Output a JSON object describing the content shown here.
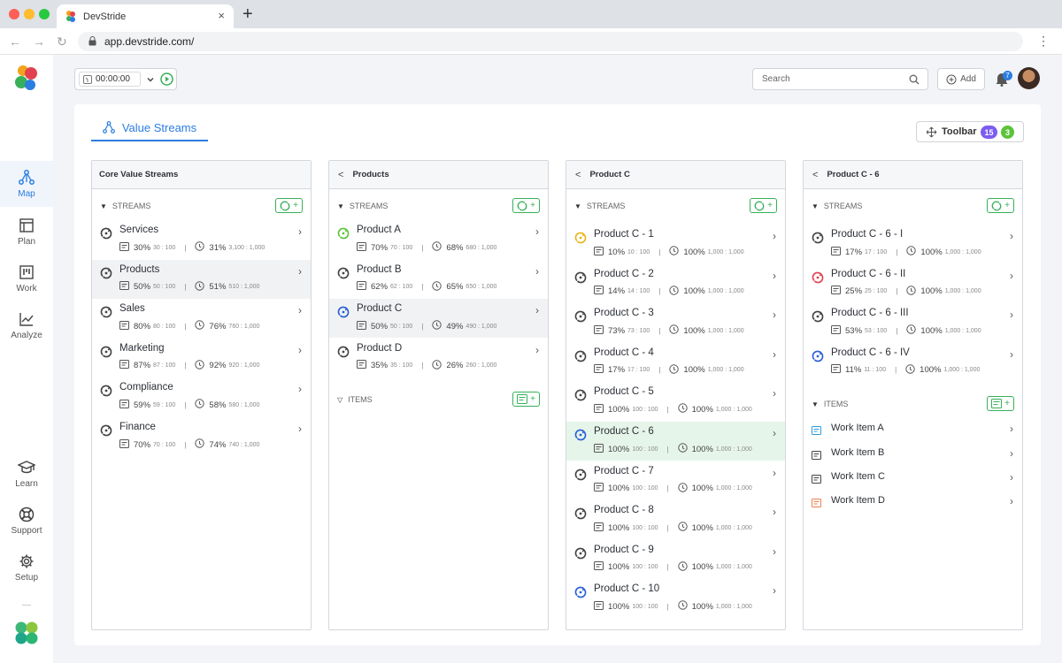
{
  "browser": {
    "tab_title": "DevStride",
    "url": "app.devstride.com/",
    "tab_close": "×",
    "new_tab": "+",
    "nav_back": "←",
    "nav_forward": "→",
    "nav_reload": "↻",
    "menu": "⋮"
  },
  "sidebar": {
    "items": [
      {
        "label": "Map",
        "icon": "map-icon",
        "active": true
      },
      {
        "label": "Plan",
        "icon": "plan-icon"
      },
      {
        "label": "Work",
        "icon": "work-icon"
      },
      {
        "label": "Analyze",
        "icon": "analyze-icon"
      },
      {
        "label": "Learn",
        "icon": "learn-icon"
      },
      {
        "label": "Support",
        "icon": "support-icon"
      },
      {
        "label": "Setup",
        "icon": "setup-icon"
      }
    ]
  },
  "topbar": {
    "timer_value": "00:00:00",
    "search_placeholder": "Search",
    "add_label": "Add",
    "notification_count": "7"
  },
  "page": {
    "tab_label": "Value Streams",
    "toolbar_label": "Toolbar",
    "toolbar_badge_1": "15",
    "toolbar_badge_2": "3"
  },
  "colors": {
    "accent": "#2a7de1",
    "green": "#38b05a",
    "purple": "#7b5cf0",
    "lime": "#5cc33a"
  },
  "columns": [
    {
      "title": "Core Value Streams",
      "back": false,
      "streams_label": "STREAMS",
      "streams": [
        {
          "name": "Services",
          "pct1": "30%",
          "frac1": "30 : 100",
          "pct2": "31%",
          "frac2": "3,100 : 1,000",
          "icon_color": "#444"
        },
        {
          "name": "Products",
          "pct1": "50%",
          "frac1": "50 : 100",
          "pct2": "51%",
          "frac2": "510 : 1,000",
          "icon_color": "#444",
          "state": "hl"
        },
        {
          "name": "Sales",
          "pct1": "80%",
          "frac1": "80 : 100",
          "pct2": "76%",
          "frac2": "760 : 1,000",
          "icon_color": "#444"
        },
        {
          "name": "Marketing",
          "pct1": "87%",
          "frac1": "87 : 100",
          "pct2": "92%",
          "frac2": "920 : 1,000",
          "icon_color": "#444"
        },
        {
          "name": "Compliance",
          "pct1": "59%",
          "frac1": "59 : 100",
          "pct2": "58%",
          "frac2": "580 : 1,000",
          "icon_color": "#444"
        },
        {
          "name": "Finance",
          "pct1": "70%",
          "frac1": "70 : 100",
          "pct2": "74%",
          "frac2": "740 : 1,000",
          "icon_color": "#444"
        }
      ]
    },
    {
      "title": "Products",
      "back": true,
      "streams_label": "STREAMS",
      "items_label": "ITEMS",
      "streams": [
        {
          "name": "Product A",
          "pct1": "70%",
          "frac1": "70 : 100",
          "pct2": "68%",
          "frac2": "680 : 1,000",
          "icon_color": "#5cc33a"
        },
        {
          "name": "Product B",
          "pct1": "62%",
          "frac1": "62 : 100",
          "pct2": "65%",
          "frac2": "650 : 1,000",
          "icon_color": "#444"
        },
        {
          "name": "Product C",
          "pct1": "50%",
          "frac1": "50 : 100",
          "pct2": "49%",
          "frac2": "490 : 1,000",
          "icon_color": "#2a5fd6",
          "state": "hl"
        },
        {
          "name": "Product D",
          "pct1": "35%",
          "frac1": "35 : 100",
          "pct2": "26%",
          "frac2": "260 : 1,000",
          "icon_color": "#444"
        }
      ]
    },
    {
      "title": "Product C",
      "back": true,
      "streams_label": "STREAMS",
      "streams": [
        {
          "name": "Product C - 1",
          "pct1": "10%",
          "frac1": "10 : 100",
          "pct2": "100%",
          "frac2": "1,000 : 1,000",
          "icon_color": "#e8b51c"
        },
        {
          "name": "Product C - 2",
          "pct1": "14%",
          "frac1": "14 : 100",
          "pct2": "100%",
          "frac2": "1,000 : 1,000",
          "icon_color": "#444"
        },
        {
          "name": "Product C - 3",
          "pct1": "73%",
          "frac1": "73 : 100",
          "pct2": "100%",
          "frac2": "1,000 : 1,000",
          "icon_color": "#444"
        },
        {
          "name": "Product C - 4",
          "pct1": "17%",
          "frac1": "17 : 100",
          "pct2": "100%",
          "frac2": "1,000 : 1,000",
          "icon_color": "#444"
        },
        {
          "name": "Product C - 5",
          "pct1": "100%",
          "frac1": "100 : 100",
          "pct2": "100%",
          "frac2": "1,000 : 1,000",
          "icon_color": "#444"
        },
        {
          "name": "Product C - 6",
          "pct1": "100%",
          "frac1": "100 : 100",
          "pct2": "100%",
          "frac2": "1,000 : 1,000",
          "icon_color": "#2a5fd6",
          "state": "green"
        },
        {
          "name": "Product C - 7",
          "pct1": "100%",
          "frac1": "100 : 100",
          "pct2": "100%",
          "frac2": "1,000 : 1,000",
          "icon_color": "#444"
        },
        {
          "name": "Product C - 8",
          "pct1": "100%",
          "frac1": "100 : 100",
          "pct2": "100%",
          "frac2": "1,000 : 1,000",
          "icon_color": "#444"
        },
        {
          "name": "Product C - 9",
          "pct1": "100%",
          "frac1": "100 : 100",
          "pct2": "100%",
          "frac2": "1,000 : 1,000",
          "icon_color": "#444"
        },
        {
          "name": "Product C - 10",
          "pct1": "100%",
          "frac1": "100 : 100",
          "pct2": "100%",
          "frac2": "1,000 : 1,000",
          "icon_color": "#2a5fd6"
        }
      ]
    },
    {
      "title": "Product C - 6",
      "back": true,
      "streams_label": "STREAMS",
      "items_label": "ITEMS",
      "streams": [
        {
          "name": "Product C - 6 - I",
          "pct1": "17%",
          "frac1": "17 : 100",
          "pct2": "100%",
          "frac2": "1,000 : 1,000",
          "icon_color": "#444"
        },
        {
          "name": "Product C - 6 - II",
          "pct1": "25%",
          "frac1": "25 : 100",
          "pct2": "100%",
          "frac2": "1,000 : 1,000",
          "icon_color": "#e2424f"
        },
        {
          "name": "Product C - 6 - III",
          "pct1": "53%",
          "frac1": "53 : 100",
          "pct2": "100%",
          "frac2": "1,000 : 1,000",
          "icon_color": "#444"
        },
        {
          "name": "Product C - 6 - IV",
          "pct1": "11%",
          "frac1": "11 : 100",
          "pct2": "100%",
          "frac2": "1,000 : 1,000",
          "icon_color": "#2a5fd6"
        }
      ],
      "items": [
        {
          "name": "Work Item A",
          "icon_color": "#2a9de1"
        },
        {
          "name": "Work Item B",
          "icon_color": "#444"
        },
        {
          "name": "Work Item C",
          "icon_color": "#444"
        },
        {
          "name": "Work Item D",
          "icon_color": "#ee7d4e"
        }
      ]
    }
  ]
}
